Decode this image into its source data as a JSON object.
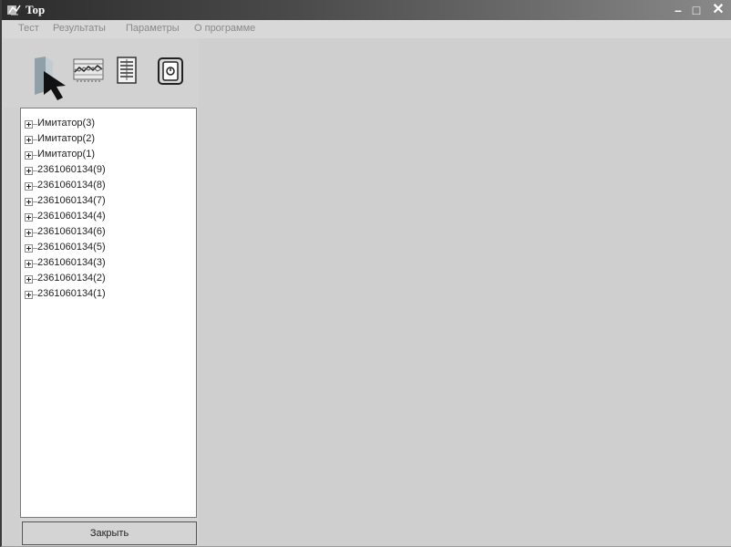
{
  "window": {
    "title": "Top",
    "controls": {
      "minimize": "–",
      "maximize": "□",
      "close": "✕"
    }
  },
  "menu": {
    "items": [
      "Тест",
      "Результаты",
      "Параметры",
      "О программе"
    ]
  },
  "toolbar": {
    "icons": [
      "pointer-icon",
      "graph-icon",
      "table-icon",
      "device-icon"
    ]
  },
  "tree": {
    "items": [
      "Имитатор(3)",
      "Имитатор(2)",
      "Имитатор(1)",
      "2361060134(9)",
      "2361060134(8)",
      "2361060134(7)",
      "2361060134(4)",
      "2361060134(6)",
      "2361060134(5)",
      "2361060134(3)",
      "2361060134(2)",
      "2361060134(1)"
    ]
  },
  "buttons": {
    "close_label": "Закрыть"
  }
}
